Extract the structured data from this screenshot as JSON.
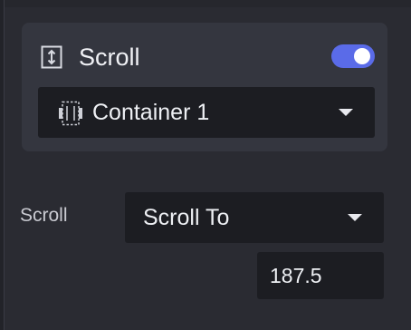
{
  "scroll_card": {
    "title": "Scroll",
    "title_icon": "vertical-resize-icon",
    "enabled": true,
    "accent_color": "#5a6be8",
    "target": {
      "icon": "container-icon",
      "value": "Container 1"
    }
  },
  "scroll_property": {
    "label": "Scroll",
    "action": "Scroll To",
    "amount": "187.5"
  }
}
